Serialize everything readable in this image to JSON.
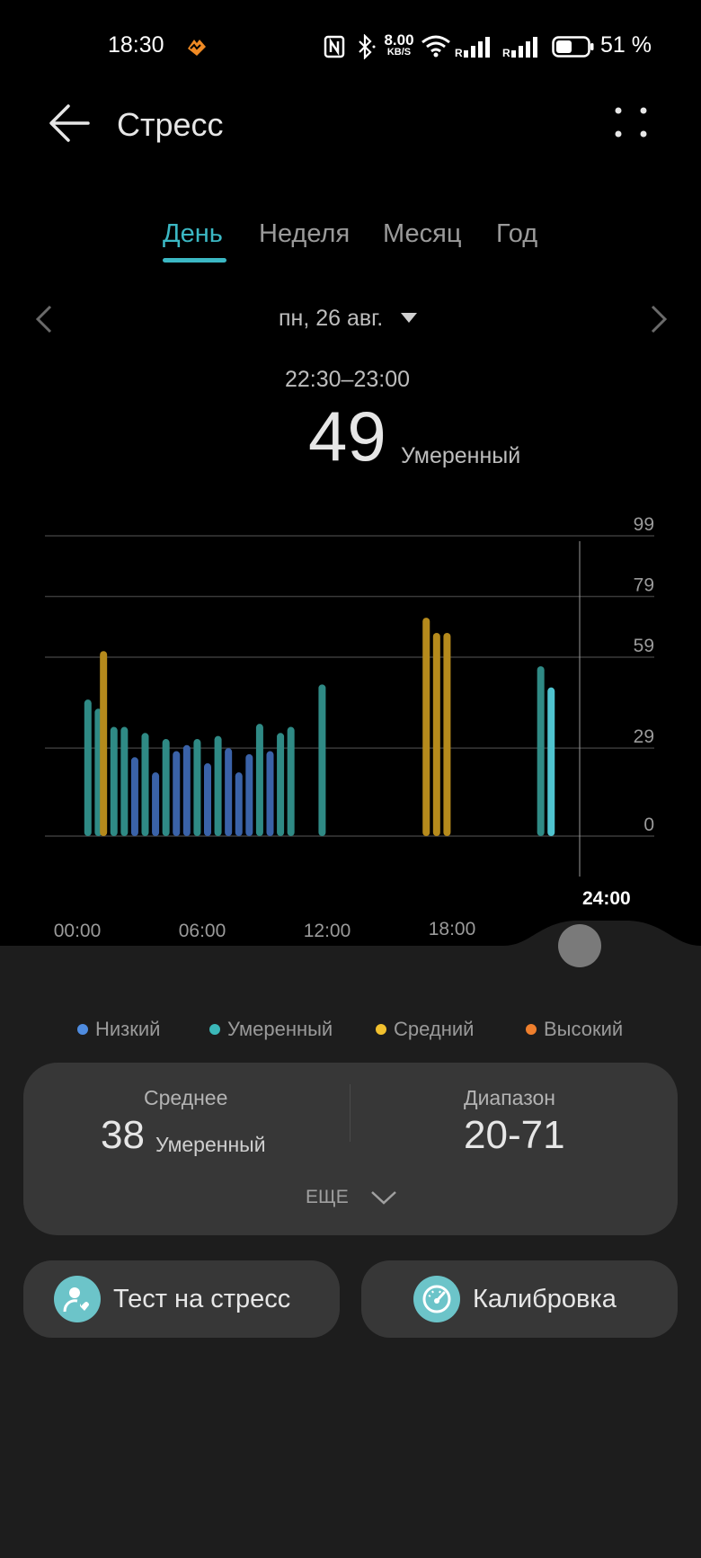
{
  "status_bar": {
    "time": "18:30",
    "network_speed_value": "8.00",
    "network_speed_unit": "KB/S",
    "signal_marker_1": "R",
    "signal_marker_2": "R",
    "battery_percent": "51 %",
    "icons": [
      "health-app-icon",
      "nfc-icon",
      "bluetooth-icon",
      "wifi-icon",
      "signal-icon",
      "signal-icon",
      "battery-icon"
    ]
  },
  "header": {
    "title": "Стресс",
    "back_icon": "back-arrow-icon",
    "menu_icon": "more-dots-icon"
  },
  "tabs": [
    {
      "label": "День",
      "active": true
    },
    {
      "label": "Неделя",
      "active": false
    },
    {
      "label": "Месяц",
      "active": false
    },
    {
      "label": "Год",
      "active": false
    }
  ],
  "date": {
    "label": "пн, 26 авг.",
    "selected_range": "22:30–23:00",
    "selected_value": "49",
    "selected_level": "Умеренный"
  },
  "chart_data": {
    "type": "bar",
    "y_ticks": [
      "99",
      "79",
      "59",
      "29",
      "0"
    ],
    "ylim": [
      0,
      99
    ],
    "x_ticks": [
      "00:00",
      "06:00",
      "12:00",
      "18:00"
    ],
    "cursor_label": "24:00",
    "x_unit": "hours",
    "xlim": [
      0,
      24
    ],
    "grid": true,
    "bars": [
      {
        "x": 0.25,
        "value": 45,
        "level": "moderate"
      },
      {
        "x": 0.75,
        "value": 42,
        "level": "moderate"
      },
      {
        "x": 1.0,
        "value": 61,
        "level": "medium"
      },
      {
        "x": 1.5,
        "value": 36,
        "level": "moderate"
      },
      {
        "x": 2.0,
        "value": 36,
        "level": "moderate"
      },
      {
        "x": 2.5,
        "value": 26,
        "level": "low"
      },
      {
        "x": 3.0,
        "value": 34,
        "level": "moderate"
      },
      {
        "x": 3.5,
        "value": 21,
        "level": "low"
      },
      {
        "x": 4.0,
        "value": 32,
        "level": "moderate"
      },
      {
        "x": 4.5,
        "value": 28,
        "level": "low"
      },
      {
        "x": 5.0,
        "value": 30,
        "level": "low"
      },
      {
        "x": 5.5,
        "value": 32,
        "level": "moderate"
      },
      {
        "x": 6.0,
        "value": 24,
        "level": "low"
      },
      {
        "x": 6.5,
        "value": 33,
        "level": "moderate"
      },
      {
        "x": 7.0,
        "value": 29,
        "level": "low"
      },
      {
        "x": 7.5,
        "value": 21,
        "level": "low"
      },
      {
        "x": 8.0,
        "value": 27,
        "level": "low"
      },
      {
        "x": 8.5,
        "value": 37,
        "level": "moderate"
      },
      {
        "x": 9.0,
        "value": 28,
        "level": "low"
      },
      {
        "x": 9.5,
        "value": 34,
        "level": "moderate"
      },
      {
        "x": 10.0,
        "value": 36,
        "level": "moderate"
      },
      {
        "x": 11.5,
        "value": 50,
        "level": "moderate"
      },
      {
        "x": 16.5,
        "value": 72,
        "level": "medium"
      },
      {
        "x": 17.0,
        "value": 67,
        "level": "medium"
      },
      {
        "x": 17.5,
        "value": 67,
        "level": "medium"
      },
      {
        "x": 22.0,
        "value": 56,
        "level": "moderate"
      },
      {
        "x": 22.5,
        "value": 49,
        "level": "moderate",
        "selected": true
      }
    ]
  },
  "legend": [
    {
      "label": "Низкий",
      "color": "#4f8ce0"
    },
    {
      "label": "Умеренный",
      "color": "#3bb8b9"
    },
    {
      "label": "Средний",
      "color": "#f2c12e"
    },
    {
      "label": "Высокий",
      "color": "#ef7f2d"
    }
  ],
  "bar_colors": {
    "low": "#3a62a8",
    "moderate": "#2f8a85",
    "medium": "#b58a1c",
    "selected": "#4fc3cf"
  },
  "stats": {
    "average_label": "Среднее",
    "average_value": "38",
    "average_level": "Умеренный",
    "range_label": "Диапазон",
    "range_value": "20-71",
    "more_label": "ЕЩЕ"
  },
  "actions": [
    {
      "label": "Тест на стресс",
      "icon": "stress-test-icon"
    },
    {
      "label": "Калибровка",
      "icon": "calibration-gauge-icon"
    }
  ]
}
